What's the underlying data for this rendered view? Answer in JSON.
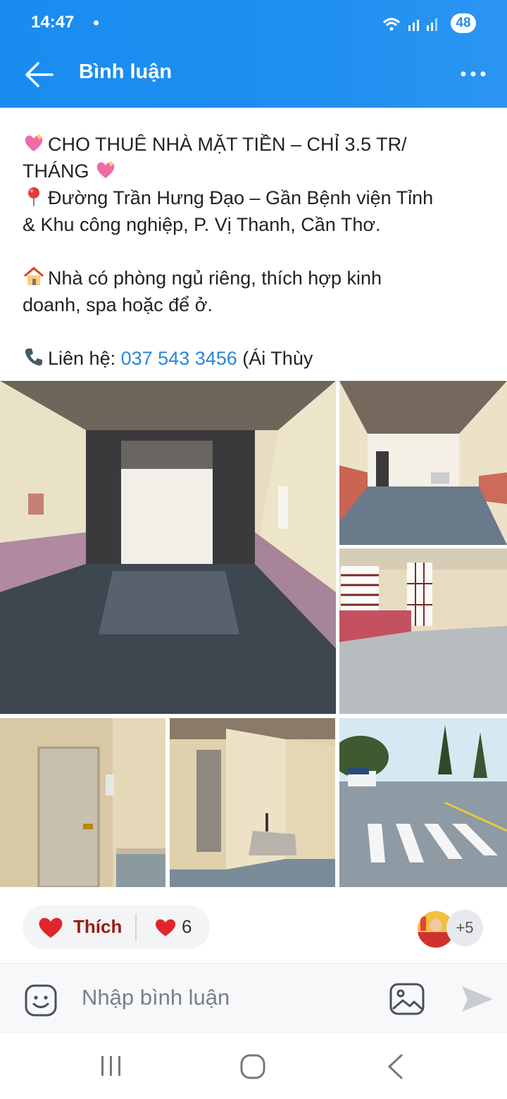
{
  "status_bar": {
    "time": "14:47",
    "battery": "48"
  },
  "header": {
    "title": "Bình luận"
  },
  "post": {
    "line1": "CHO THUÊ NHÀ MẶT TIỀN – CHỈ 3.5 TR/",
    "line2": "THÁNG",
    "line3": "Đường Trần Hưng Đạo – Gần Bệnh viện Tỉnh",
    "line4": "& Khu công nghiệp, P. Vị Thanh, Cần Thơ.",
    "line5": "Nhà có phòng ngủ riêng, thích hợp kinh",
    "line6": "doanh, spa hoặc để ở.",
    "contact_label": "Liên hệ:",
    "phone": "037 543 3456",
    "contact_suffix": "(Ái Thùy"
  },
  "reactions": {
    "like_label": "Thích",
    "count": "6",
    "more_reactors": "+5"
  },
  "comment": {
    "placeholder": "Nhập bình luận"
  },
  "colors": {
    "header": "#1e8ff0",
    "link": "#2a86d6",
    "like_text": "#9b1b14",
    "heart": "#e0262c"
  },
  "icons": [
    "back-arrow-icon",
    "more-icon",
    "sparkle-heart-icon",
    "pin-icon",
    "house-icon",
    "phone-icon",
    "heart-icon",
    "sticker-icon",
    "image-icon",
    "send-icon",
    "recent-apps-icon",
    "home-icon",
    "nav-back-icon"
  ]
}
